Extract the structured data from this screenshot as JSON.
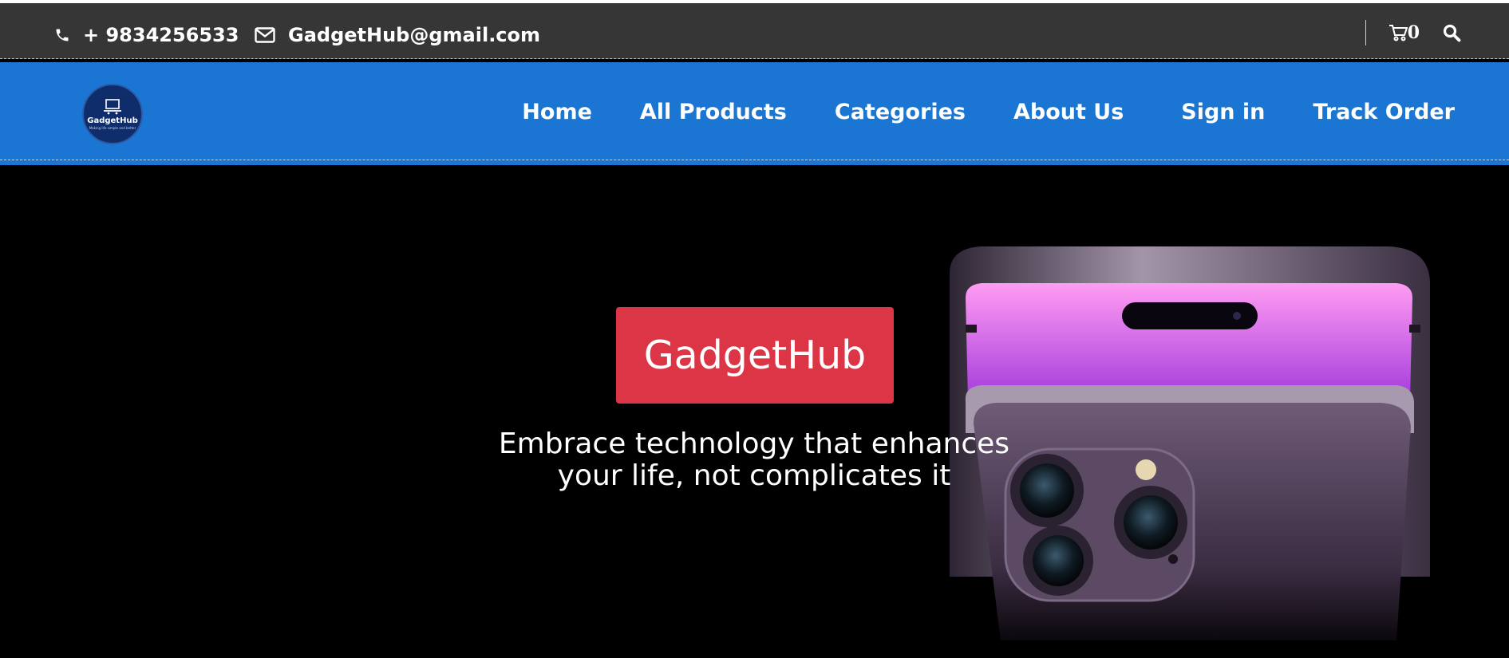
{
  "topbar": {
    "phone": "+ 9834256533",
    "email": "GadgetHub@gmail.com",
    "cart_count": "0",
    "icons": {
      "phone": "phone-icon",
      "email": "envelope-icon",
      "cart": "cart-icon",
      "search": "search-icon"
    }
  },
  "header": {
    "logo_name": "GadgetHub",
    "logo_tagline": "Making life simple and better",
    "nav": {
      "home": "Home",
      "all_products": "All Products",
      "categories": "Categories",
      "about_us": "About Us",
      "sign_in": "Sign in",
      "track_order": "Track Order"
    }
  },
  "hero": {
    "title": "GadgetHub",
    "tagline_line1": "Embrace technology that enhances",
    "tagline_line2": "your life, not complicates it"
  },
  "colors": {
    "topbar_bg": "#363636",
    "navbar_bg": "#1b76d3",
    "hero_bg": "#000000",
    "hero_title_bg": "#dc3545",
    "phone_purple": "#5b4468"
  }
}
